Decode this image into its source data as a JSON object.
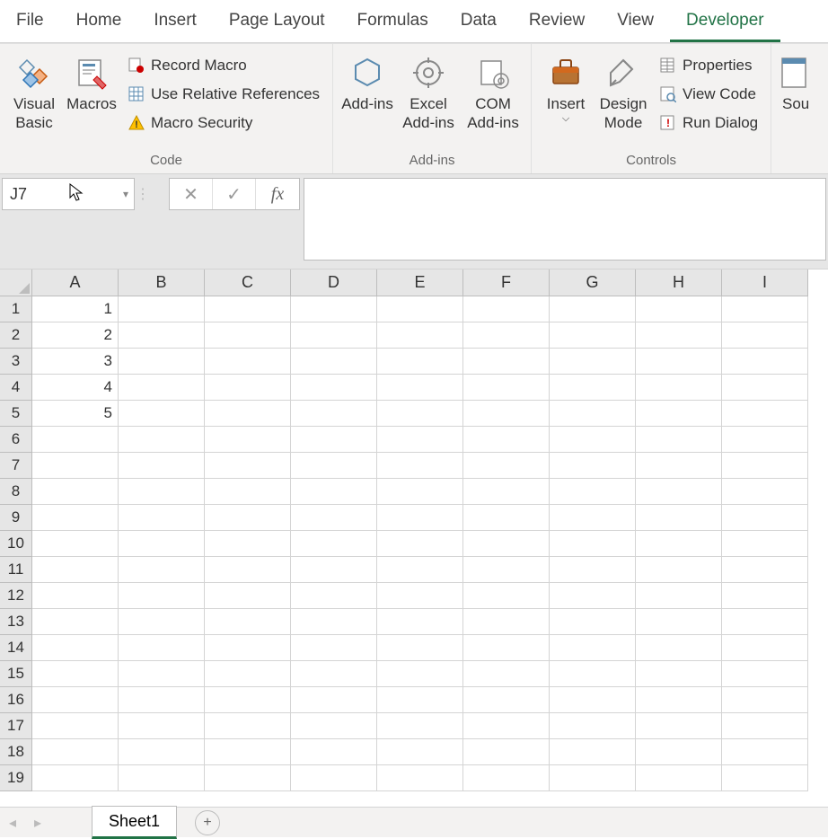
{
  "ribbon": {
    "tabs": [
      "File",
      "Home",
      "Insert",
      "Page Layout",
      "Formulas",
      "Data",
      "Review",
      "View",
      "Developer"
    ],
    "active_tab": "Developer",
    "groups": {
      "code": {
        "label": "Code",
        "visual_basic": "Visual Basic",
        "macros": "Macros",
        "record_macro": "Record Macro",
        "use_relative": "Use Relative References",
        "macro_security": "Macro Security"
      },
      "addins": {
        "label": "Add-ins",
        "addins": "Add-ins",
        "excel_addins": "Excel Add-ins",
        "com_addins": "COM Add-ins"
      },
      "controls": {
        "label": "Controls",
        "insert": "Insert",
        "design_mode": "Design Mode",
        "properties": "Properties",
        "view_code": "View Code",
        "run_dialog": "Run Dialog"
      },
      "xml": {
        "source": "Sou"
      }
    }
  },
  "name_box": "J7",
  "formula_bar": "",
  "columns": [
    "A",
    "B",
    "C",
    "D",
    "E",
    "F",
    "G",
    "H",
    "I"
  ],
  "rows": [
    "1",
    "2",
    "3",
    "4",
    "5",
    "6",
    "7",
    "8",
    "9",
    "10",
    "11",
    "12",
    "13",
    "14",
    "15",
    "16",
    "17",
    "18",
    "19"
  ],
  "cells": {
    "A1": "1",
    "A2": "2",
    "A3": "3",
    "A4": "4",
    "A5": "5"
  },
  "sheet": {
    "name": "Sheet1"
  }
}
